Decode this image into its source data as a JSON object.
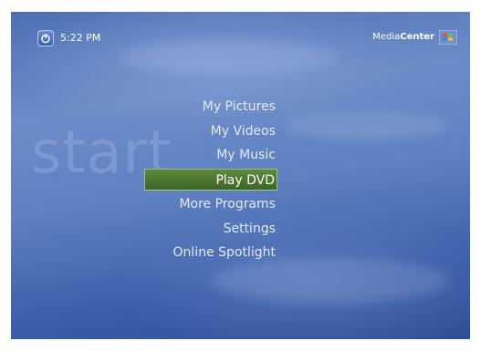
{
  "header": {
    "time": "5:22 PM",
    "brand_prefix": "Media",
    "brand_suffix": "Center"
  },
  "watermark": "start",
  "menu": {
    "selected_index": 3,
    "items": [
      {
        "label": "My Pictures"
      },
      {
        "label": "My Videos"
      },
      {
        "label": "My Music"
      },
      {
        "label": "Play DVD"
      },
      {
        "label": "More Programs"
      },
      {
        "label": "Settings"
      },
      {
        "label": "Online Spotlight"
      }
    ]
  },
  "colors": {
    "background": "#5f81c2",
    "selection": "#4e7a35",
    "text": "#e3e9f6"
  },
  "icons": {
    "power": "power-icon",
    "logo": "windows-flag-icon"
  }
}
